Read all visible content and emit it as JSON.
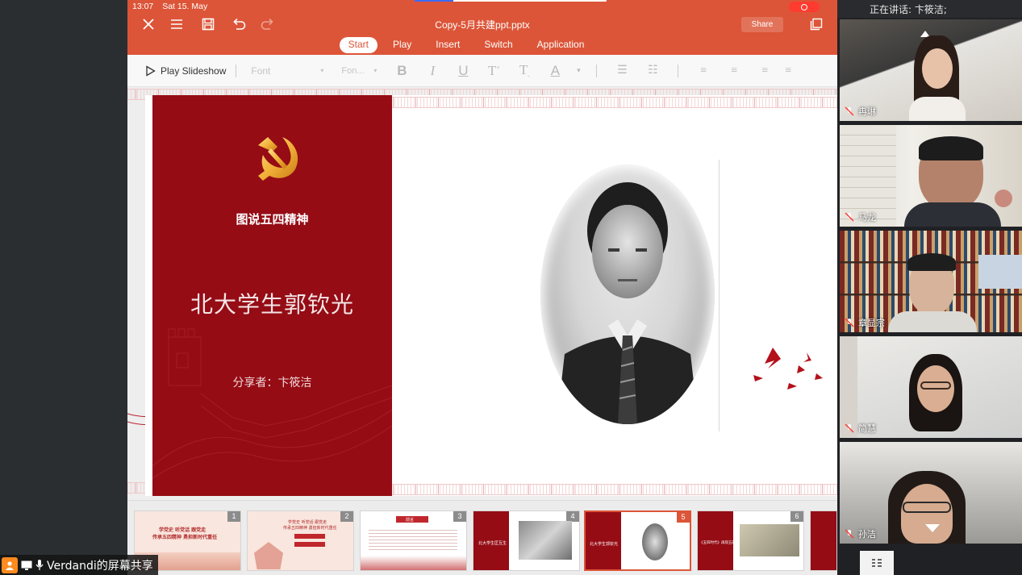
{
  "status_bar": {
    "time": "13:07",
    "date": "Sat 15. May"
  },
  "app": {
    "doc_title": "Copy-5月共建ppt.pptx",
    "share_label": "Share",
    "tabs": [
      {
        "label": "Start",
        "active": true
      },
      {
        "label": "Play",
        "active": false
      },
      {
        "label": "Insert",
        "active": false
      },
      {
        "label": "Switch",
        "active": false
      },
      {
        "label": "Application",
        "active": false
      }
    ],
    "accent_color": "#dc5538"
  },
  "toolbar": {
    "play_slideshow": "Play Slideshow",
    "font_placeholder": "Font",
    "font_size_placeholder": "Fon...",
    "format_icons": [
      "bold-icon",
      "italic-icon",
      "underline-icon",
      "superscript-icon",
      "subscript-icon",
      "font-color-icon",
      "bullet-list-icon",
      "numbered-list-icon",
      "align-left-icon",
      "align-center-icon",
      "align-right-icon"
    ]
  },
  "slide": {
    "subtitle": "图说五四精神",
    "title": "北大学生郭钦光",
    "sharer": "分享者：卞筱洁",
    "panel_color": "#950c15"
  },
  "thumbnails": [
    {
      "num": "1",
      "line1": "学党史 听党话 跟党走",
      "line2": "传承五四精神 勇担新时代重任"
    },
    {
      "num": "2",
      "line1": "学党史 听党话 跟党走",
      "line2": "传承五四精神 勇担新时代重任"
    },
    {
      "num": "3",
      "line1": "前言",
      "line2": ""
    },
    {
      "num": "4",
      "line1": "北大学生匡互生",
      "line2": ""
    },
    {
      "num": "5",
      "line1": "北大学生郭钦光",
      "line2": ""
    },
    {
      "num": "6",
      "line1": "《五四时代》再现五四运动",
      "line2": ""
    }
  ],
  "video_panel": {
    "current_speaker": "正在讲话: 卞筱洁;",
    "participants": [
      {
        "name": "冉琳"
      },
      {
        "name": "马龙"
      },
      {
        "name": "章显宗"
      },
      {
        "name": "简慧"
      },
      {
        "name": "孙洁"
      }
    ]
  },
  "screen_share": {
    "label": "Verdandi的屏幕共享"
  }
}
